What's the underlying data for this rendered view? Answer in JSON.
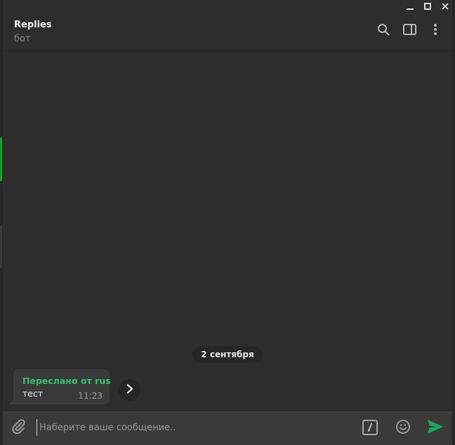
{
  "header": {
    "title": "Replies",
    "subtitle": "бот"
  },
  "messages": {
    "date_separator": "2 сентября",
    "items": [
      {
        "forwarded_from": "Переслано от rus",
        "text": "тест",
        "time": "11:23"
      }
    ]
  },
  "composer": {
    "placeholder": "Наберите ваше сообщение.."
  },
  "colors": {
    "accent": "#34c46a",
    "send": "#1aa760",
    "active_marker": "#1a9f2a"
  },
  "icons": {
    "window": [
      "minimize-icon",
      "maximize-icon",
      "close-icon"
    ],
    "header": [
      "search-icon",
      "sidebar-toggle-icon",
      "more-vertical-icon"
    ],
    "composer": [
      "paperclip-icon",
      "bot-command-icon",
      "emoji-icon",
      "send-icon"
    ],
    "message": [
      "chevron-right-icon"
    ]
  }
}
